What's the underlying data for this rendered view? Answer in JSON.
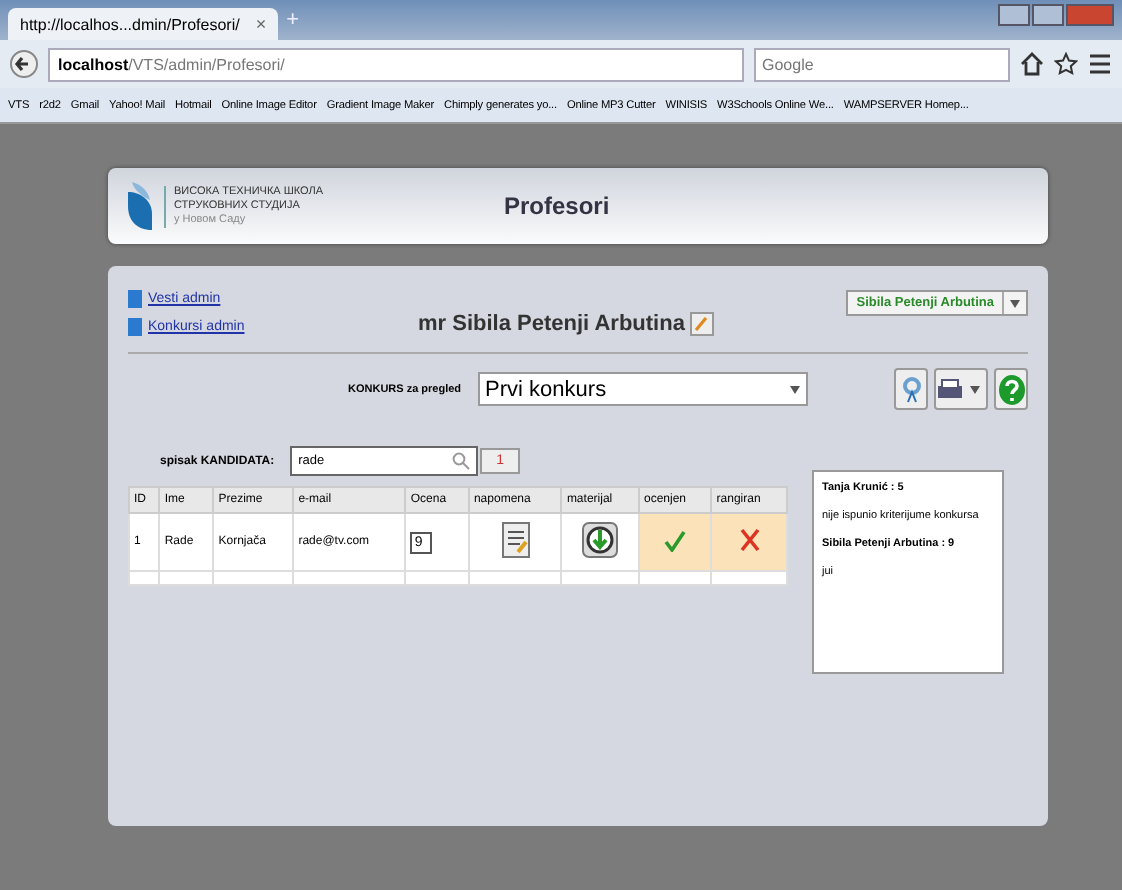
{
  "browser": {
    "tab_title": "http://localhos...dmin/Profesori/",
    "tab_close": "×",
    "new_tab": "+",
    "url_host": "localhost",
    "url_path": "/VTS/admin/Profesori/",
    "search_placeholder": "Google",
    "bookmarks": [
      "VTS",
      "r2d2",
      "Gmail",
      "Yahoo! Mail",
      "Hotmail",
      "Online Image Editor",
      "Gradient Image Maker",
      "Chimply generates yo...",
      "Online MP3 Cutter",
      "WINISIS",
      "W3Schools Online We...",
      "WAMPSERVER Homep..."
    ]
  },
  "header": {
    "logo_lines": [
      "ВИСОКА ТЕХНИЧКА ШКОЛА",
      "СТРУКОВНИХ СТУДИЈА",
      "у Новом Саду"
    ],
    "title": "Profesori"
  },
  "nav_links": [
    "Vesti admin",
    "Konkursi admin"
  ],
  "professor_name": "mr Sibila Petenji Arbutina",
  "user_menu": "Sibila Petenji Arbutina",
  "contest": {
    "label": "KONKURS za pregled",
    "value": "Prvi konkurs"
  },
  "candidates": {
    "label": "spisak KANDIDATA:",
    "search_value": "rade",
    "count": "1"
  },
  "table": {
    "columns": [
      "ID",
      "Ime",
      "Prezime",
      "e-mail",
      "Ocena",
      "napomena",
      "materijal",
      "ocenjen",
      "rangiran"
    ],
    "rows": [
      {
        "id": "1",
        "first_name": "Rade",
        "last_name": "Kornjača",
        "email": "rade@tv.com",
        "grade": "9",
        "graded": true,
        "ranked": false
      }
    ]
  },
  "comments": [
    {
      "author": "Tanja Krunić : 5",
      "text": "nije ispunio kriterijume konkursa"
    },
    {
      "author": "Sibila Petenji Arbutina : 9",
      "text": "jui"
    }
  ]
}
